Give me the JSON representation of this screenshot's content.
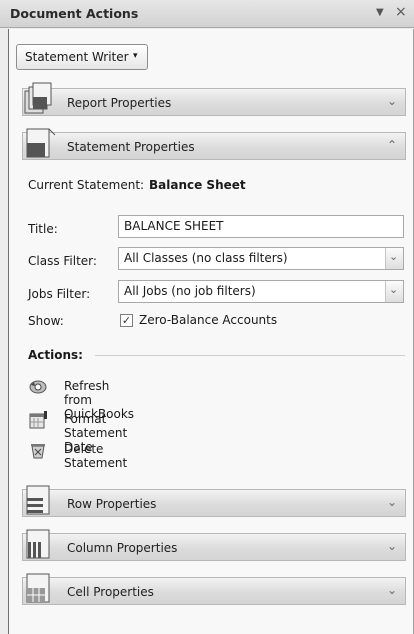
{
  "window": {
    "title": "Document Actions",
    "dropdown_glyph": "▼",
    "close_glyph": "×"
  },
  "toolbar": {
    "writer_label": "Statement Writer",
    "writer_arrow": "▾"
  },
  "sections": {
    "report": {
      "label": "Report Properties",
      "chevron": "⌄",
      "expanded": false
    },
    "statement": {
      "label": "Statement Properties",
      "chevron": "⌃",
      "expanded": true
    },
    "row": {
      "label": "Row Properties",
      "chevron": "⌄",
      "expanded": false
    },
    "column": {
      "label": "Column Properties",
      "chevron": "⌄",
      "expanded": false
    },
    "cell": {
      "label": "Cell Properties",
      "chevron": "⌄",
      "expanded": false
    }
  },
  "statement": {
    "current_label": "Current Statement:",
    "current_value": "Balance Sheet",
    "title_label": "Title:",
    "title_value": "BALANCE SHEET",
    "class_label": "Class Filter:",
    "class_value": "All Classes (no class filters)",
    "jobs_label": "Jobs Filter:",
    "jobs_value": "All Jobs (no job filters)",
    "show_label": "Show:",
    "zero_balance_label": "Zero-Balance Accounts",
    "zero_balance_checked": true,
    "check_glyph": "✓",
    "dropdown_glyph": "⌄"
  },
  "actions": {
    "title": "Actions:",
    "items": [
      {
        "label": "Refresh from QuickBooks",
        "icon": "refresh-icon"
      },
      {
        "label": "Format Statement Date",
        "icon": "calendar-icon"
      },
      {
        "label": "Delete Statement",
        "icon": "delete-icon"
      }
    ]
  }
}
